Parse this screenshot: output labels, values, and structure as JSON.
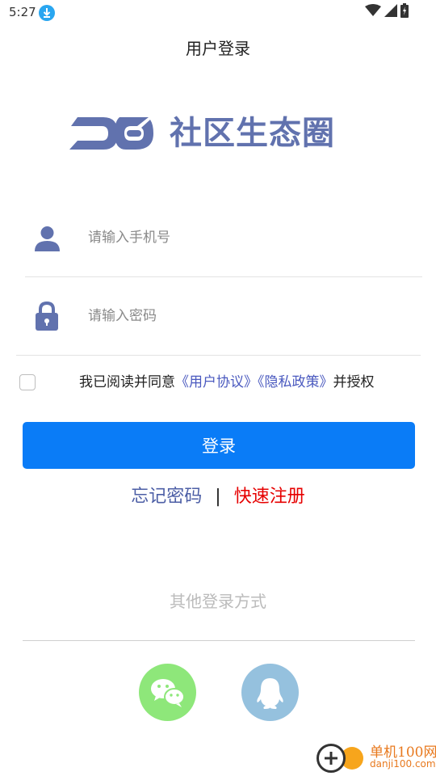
{
  "status_bar": {
    "time": "5:27",
    "icons": [
      "download-icon",
      "wifi-icon",
      "signal-icon",
      "battery-icon"
    ]
  },
  "header": {
    "title": "用户登录"
  },
  "logo": {
    "text": "社区生态圈",
    "color": "#6172ae"
  },
  "form": {
    "phone": {
      "placeholder": "请输入手机号",
      "value": "",
      "icon": "user-icon"
    },
    "password": {
      "placeholder": "请输入密码",
      "value": "",
      "icon": "lock-icon"
    },
    "agreement": {
      "checked": false,
      "prefix": "我已阅读并同意",
      "user_agreement": "《用户协议》",
      "privacy_policy": "《隐私政策》",
      "suffix": "并授权"
    },
    "login_label": "登录"
  },
  "links": {
    "forgot": "忘记密码",
    "separator": "|",
    "register": "快速注册"
  },
  "other_login": {
    "title": "其他登录方式",
    "options": [
      "wechat-icon",
      "qq-icon"
    ]
  },
  "watermark": {
    "title": "单机100网",
    "url": "danji100.com"
  },
  "colors": {
    "primary": "#0a7cf7",
    "accent": "#6172ae",
    "link": "#4a59bf",
    "danger": "#e60000",
    "wechat": "#8ee77a",
    "qq": "#95c1de"
  }
}
